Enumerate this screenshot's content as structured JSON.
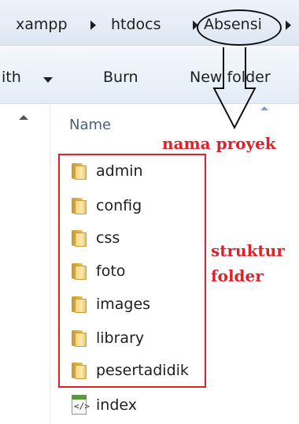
{
  "breadcrumb": {
    "items": [
      "xampp",
      "htdocs",
      "Absensi"
    ]
  },
  "toolbar": {
    "with_label": "ith",
    "burn_label": "Burn",
    "new_folder_label": "New folder"
  },
  "file_list": {
    "column_name": "Name",
    "items": [
      {
        "label": "admin",
        "type": "folder"
      },
      {
        "label": "config",
        "type": "folder"
      },
      {
        "label": "css",
        "type": "folder"
      },
      {
        "label": "foto",
        "type": "folder"
      },
      {
        "label": "images",
        "type": "folder"
      },
      {
        "label": "library",
        "type": "folder"
      },
      {
        "label": "pesertadidik",
        "type": "folder"
      },
      {
        "label": "index",
        "type": "php-file"
      }
    ]
  },
  "annotations": {
    "project_name": "nama proyek",
    "structure_line1": "struktur",
    "structure_line2": "folder",
    "color": "#e0202a"
  }
}
